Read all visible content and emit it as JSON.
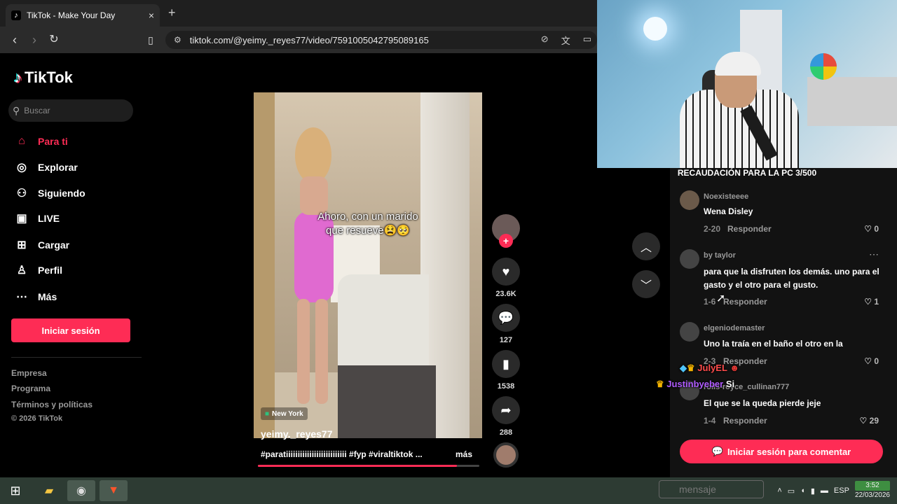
{
  "browser": {
    "tab_title": "TikTok - Make Your Day",
    "tab_close": "×",
    "new_tab": "+",
    "url": "tiktok.com/@yeimy._reyes77/video/7591005042795089165"
  },
  "sidebar": {
    "logo_text": "TikTok",
    "search_placeholder": "Buscar",
    "items": [
      {
        "label": "Para ti",
        "icon": "home-icon"
      },
      {
        "label": "Explorar",
        "icon": "compass-icon"
      },
      {
        "label": "Siguiendo",
        "icon": "following-icon"
      },
      {
        "label": "LIVE",
        "icon": "live-icon"
      },
      {
        "label": "Cargar",
        "icon": "upload-icon"
      },
      {
        "label": "Perfil",
        "icon": "profile-icon"
      },
      {
        "label": "Más",
        "icon": "more-icon"
      }
    ],
    "login_label": "Iniciar sesión",
    "footer": [
      "Empresa",
      "Programa",
      "Términos y políticas",
      "© 2026 TikTok"
    ]
  },
  "video": {
    "caption_line1": "Ahoro, con un marido",
    "caption_line2": "que resueve😫🥺",
    "location": "New York",
    "author": "yeimy._reyes77",
    "hashtags": "#paratiiiiiiiiiiiiiiiiiiiiiiiiii #fyp #viraltiktok ...",
    "more_label": "más",
    "progress": 0.9
  },
  "actions": {
    "likes": "23.6K",
    "comments": "127",
    "saves": "1538",
    "shares": "288"
  },
  "stream": {
    "banner": "RECAUDACIÓN PARA LA PC 3/500"
  },
  "comments": [
    {
      "user": "Noexisteeee",
      "text": "Wena Disley",
      "date": "2-20",
      "reply": "Responder",
      "likes": "0"
    },
    {
      "user": "by taylor",
      "text": "para que la disfruten los demás. uno para el gasto y el otro para el gusto.",
      "date": "1-6",
      "reply": "Responder",
      "likes": "1"
    },
    {
      "user": "elgeniodemaster",
      "text": "Uno la traía en el baño el otro en la",
      "date": "2-3",
      "reply": "Responder",
      "likes": "0"
    },
    {
      "user": "rolls-royce_cullinan777",
      "text": "El que se la queda pierde jeje",
      "date": "1-4",
      "reply": "Responder",
      "likes": "29"
    }
  ],
  "comment_login": "Iniciar sesión para comentar",
  "chat": [
    {
      "user": "JulyEL",
      "msg": "",
      "color": "#ff4b4b"
    },
    {
      "user": "Justinbyeber",
      "msg": "Si",
      "color": "#b05cff"
    }
  ],
  "taskbar": {
    "ghost_text": "mensaje",
    "lang": "ESP",
    "time": "3:52",
    "date": "22/03/2026"
  }
}
